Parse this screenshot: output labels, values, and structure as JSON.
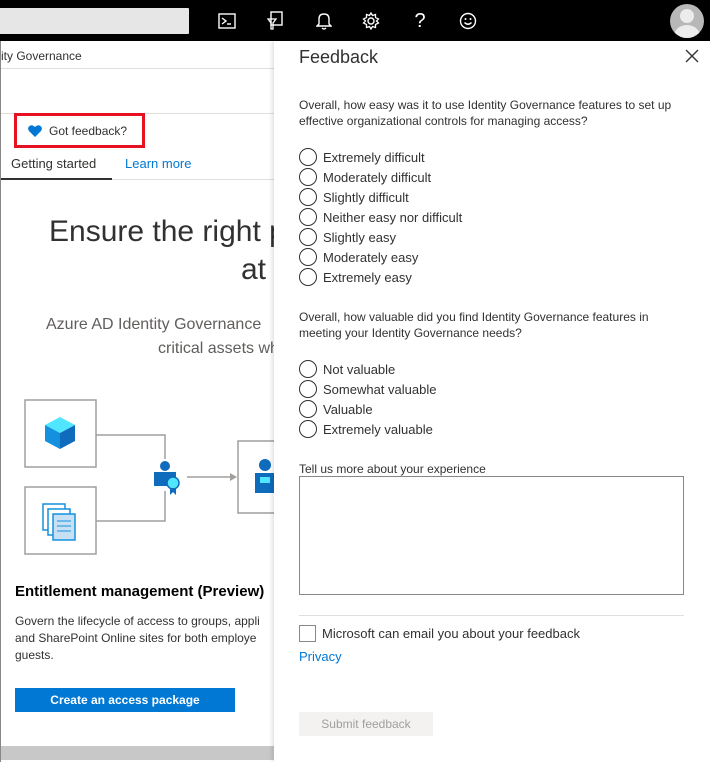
{
  "topbar": {
    "icons": [
      "cloud-shell-icon",
      "directory-filter-icon",
      "notifications-bell-icon",
      "settings-gear-icon",
      "help-icon",
      "smiley-feedback-icon"
    ],
    "help_glyph": "?"
  },
  "left": {
    "breadcrumb": "ity Governance",
    "got_feedback": "Got feedback?",
    "tabs": [
      "Getting started",
      "Learn more"
    ],
    "hero_line1": "Ensure the right p",
    "hero_line2": "at",
    "desc_line1": "Azure AD Identity Governance",
    "desc_line2": "critical assets wh",
    "section_title": "Entitlement management (Preview)",
    "section_text": [
      "Govern the lifecycle of access to groups, appli",
      "and SharePoint Online sites for both employe",
      "guests."
    ],
    "cta": "Create an access package"
  },
  "feedback": {
    "title": "Feedback",
    "q1": "Overall, how easy was it to use Identity Governance features to set up effective organizational controls for managing access?",
    "q1_options": [
      "Extremely difficult",
      "Moderately difficult",
      "Slightly difficult",
      "Neither easy nor difficult",
      "Slightly easy",
      "Moderately easy",
      "Extremely easy"
    ],
    "q2": "Overall, how valuable did you find Identity Governance features in meeting your Identity Governance needs?",
    "q2_options": [
      "Not valuable",
      "Somewhat valuable",
      "Valuable",
      "Extremely valuable"
    ],
    "tell_more": "Tell us more about your experience",
    "tell_more_value": "",
    "email_consent": "Microsoft can email you about your feedback",
    "privacy": "Privacy",
    "submit": "Submit feedback"
  },
  "colors": {
    "accent": "#0078d4",
    "highlight_border": "#e81123",
    "topbar": "#000000"
  }
}
